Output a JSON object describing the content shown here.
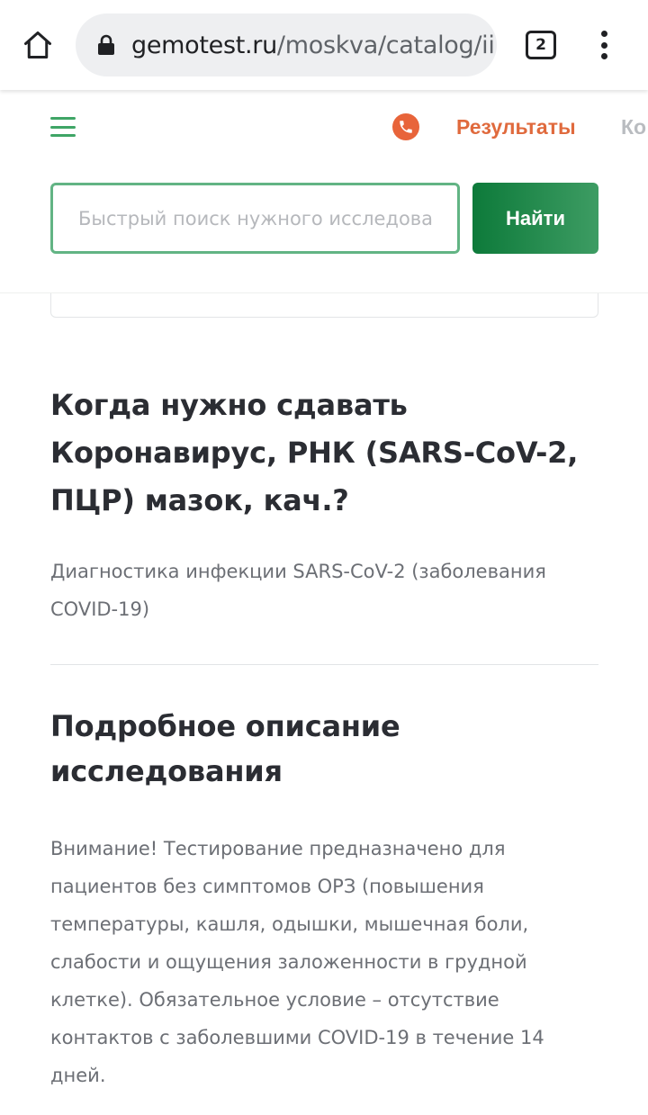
{
  "browser": {
    "url_host": "gemotest.ru",
    "url_path": "/moskva/catalog/ii",
    "tab_count": "2"
  },
  "header": {
    "results_label": "Результаты",
    "more_label": "Ко",
    "search_placeholder": "Быстрый поиск нужного исследования",
    "search_button": "Найти",
    "accent_green": "#0d7a3a",
    "accent_orange": "#e06a3d"
  },
  "content": {
    "when_title": "Когда нужно сдавать Коронавирус, РНК (SARS-CoV-2, ПЦР) мазок, кач.?",
    "when_text": "Диагностика инфекции SARS-CoV-2 (заболевания COVID-19)",
    "desc_title": "Подробное описание исследования",
    "desc_text": "Внимание! Тестирование предназначено для пациентов без симптомов ОРЗ (повышения температуры, кашля, одышки, мышечная боли, слабости и ощущения заложенности в грудной клетке). Обязательное условие – отсутствие контактов с заболевшими COVID-19 в течение 14 дней."
  }
}
